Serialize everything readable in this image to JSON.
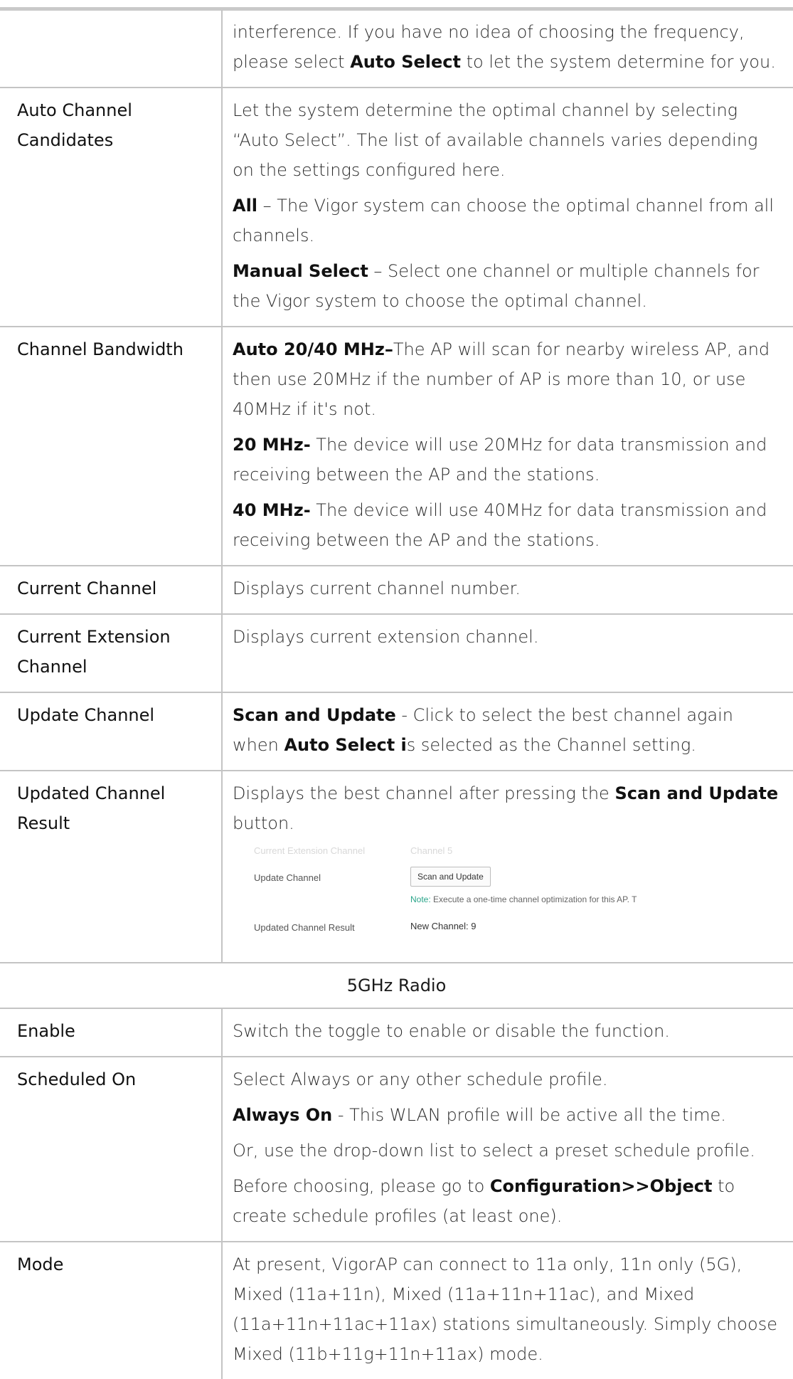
{
  "rows": [
    {
      "label": "",
      "paras": [
        [
          {
            "t": "interference. If you have no idea of choosing the frequency, please select "
          },
          {
            "t": "Auto Select",
            "b": true
          },
          {
            "t": " to let the system determine for you."
          }
        ]
      ]
    },
    {
      "label": "Auto Channel Candidates",
      "paras": [
        [
          {
            "t": "Let the system determine the optimal channel by selecting “Auto Select”. The list of available channels varies depending on the settings configured here."
          }
        ],
        [
          {
            "t": "All",
            "b": true
          },
          {
            "t": " – The Vigor system can choose the optimal channel from all channels."
          }
        ],
        [
          {
            "t": "Manual Select",
            "b": true
          },
          {
            "t": " – Select one channel or multiple channels for the Vigor system to choose the optimal channel."
          }
        ]
      ]
    },
    {
      "label": "Channel Bandwidth",
      "paras": [
        [
          {
            "t": "Auto 20/40 MHz–",
            "b": true
          },
          {
            "t": "The AP will scan for nearby wireless AP, and then use 20MHz if the number of AP is more than 10, or use 40MHz if it's not."
          }
        ],
        [
          {
            "t": "20 MHz-",
            "b": true
          },
          {
            "t": " The device will use 20MHz for data transmission and receiving between the AP and the stations."
          }
        ],
        [
          {
            "t": "40 MHz-",
            "b": true
          },
          {
            "t": " The device will use 40MHz for data transmission and receiving between the AP and the stations."
          }
        ]
      ]
    },
    {
      "label": "Current Channel",
      "paras": [
        [
          {
            "t": "Displays current channel number."
          }
        ]
      ]
    },
    {
      "label": "Current Extension Channel",
      "paras": [
        [
          {
            "t": "Displays current extension channel."
          }
        ]
      ]
    },
    {
      "label": "Update Channel",
      "paras": [
        [
          {
            "t": "Scan and Update",
            "b": true
          },
          {
            "t": " - Click to select the best channel again when "
          },
          {
            "t": "Auto Select i",
            "b": true
          },
          {
            "t": "s selected as the Channel setting."
          }
        ]
      ]
    },
    {
      "label": "Updated Channel Result",
      "paras": [
        [
          {
            "t": "Displays the best channel after pressing the "
          },
          {
            "t": "Scan and Update",
            "b": true
          },
          {
            "t": " button."
          }
        ]
      ],
      "screenshot": true
    }
  ],
  "screenshot": {
    "faded_label": "Current Extension Channel",
    "faded_value": "Channel 5",
    "update_label": "Update Channel",
    "button": "Scan and Update",
    "note_label": "Note:",
    "note_text": " Execute a one-time channel optimization for this AP. T",
    "result_label": "Updated Channel Result",
    "result_value": "New Channel: 9"
  },
  "section_title": "5GHz Radio",
  "rows2": [
    {
      "label": "Enable",
      "paras": [
        [
          {
            "t": "Switch the toggle to enable or disable the function."
          }
        ]
      ]
    },
    {
      "label": "Scheduled On",
      "paras": [
        [
          {
            "t": "Select Always or any other schedule profile."
          }
        ],
        [
          {
            "t": "Always On",
            "b": true
          },
          {
            "t": " - This WLAN profile will be active all the time."
          }
        ],
        [
          {
            "t": "Or, use the drop-down list to select a preset schedule profile."
          }
        ],
        [
          {
            "t": "Before choosing, please go to "
          },
          {
            "t": "Configuration>>Object",
            "b": true
          },
          {
            "t": " to create schedule profiles (at least one)."
          }
        ]
      ]
    },
    {
      "label": "Mode",
      "paras": [
        [
          {
            "t": "At present, VigorAP can connect to 11a only, 11n only (5G), Mixed (11a+11n), Mixed (11a+11n+11ac), and Mixed (11a+11n+11ac+11ax) stations simultaneously. Simply choose Mixed (11b+11g+11n+11ax) mode."
          }
        ]
      ]
    }
  ]
}
